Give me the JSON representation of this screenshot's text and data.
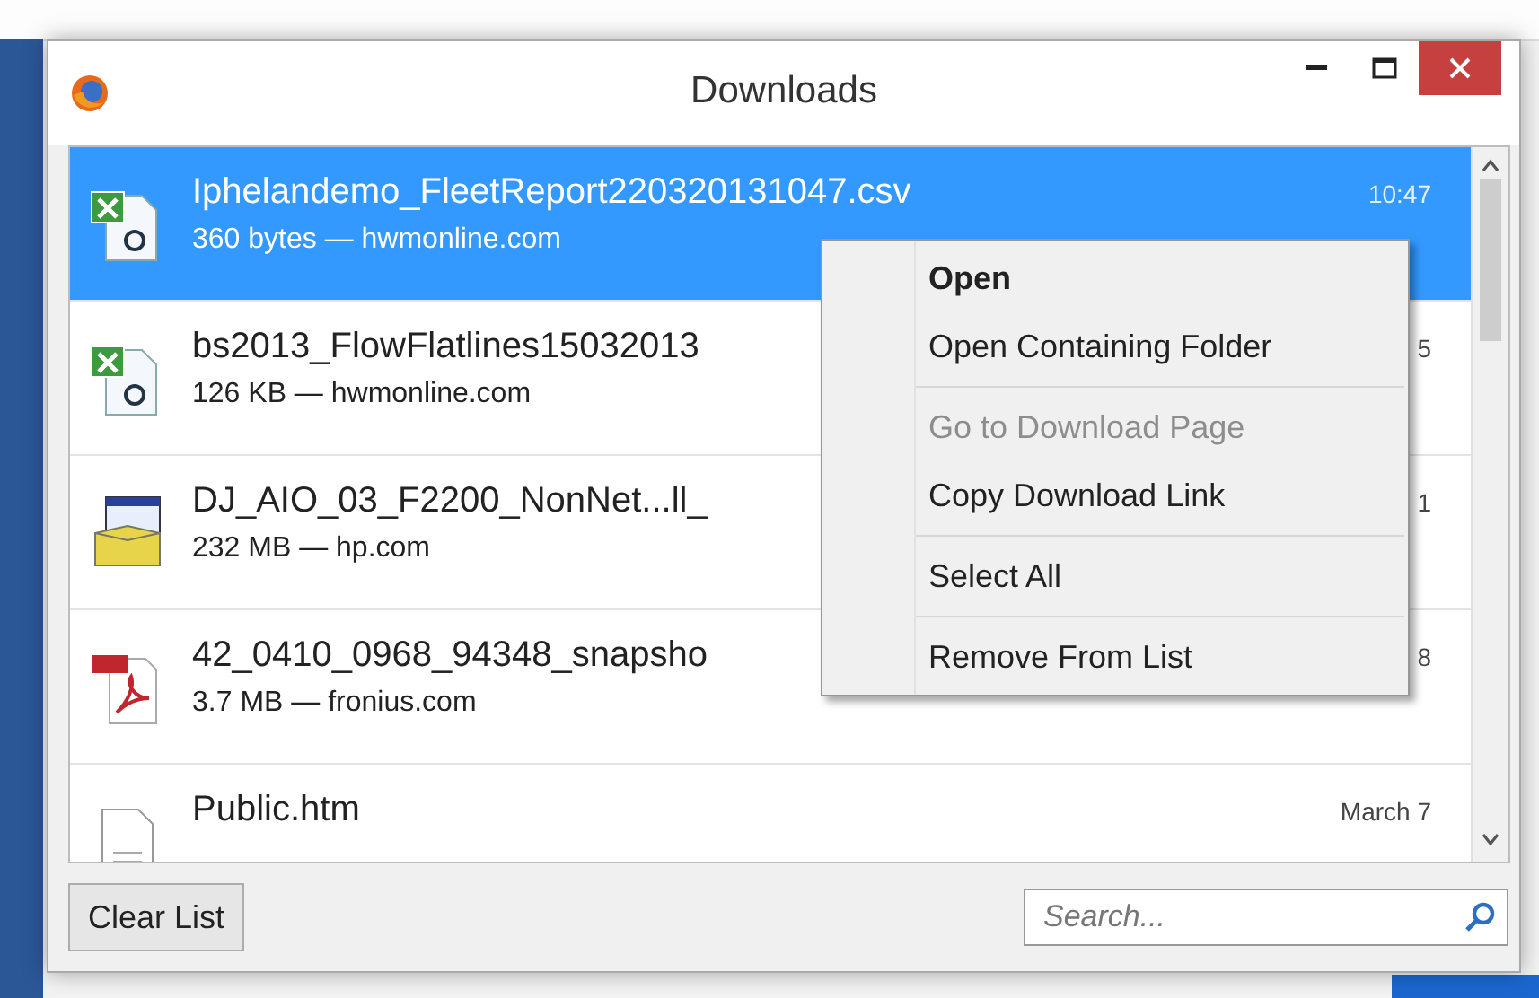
{
  "window": {
    "title": "Downloads"
  },
  "downloads": [
    {
      "kind": "spreadsheet",
      "name": "Iphelandemo_FleetReport220320131047.csv",
      "detail": "360 bytes — hwmonline.com",
      "time": "10:47",
      "selected": true
    },
    {
      "kind": "spreadsheet",
      "name": "bs2013_FlowFlatlines15032013",
      "detail": "126 KB — hwmonline.com",
      "time": "5",
      "selected": false
    },
    {
      "kind": "installer",
      "name": "DJ_AIO_03_F2200_NonNet...ll_",
      "detail": "232 MB — hp.com",
      "time": "1",
      "selected": false
    },
    {
      "kind": "pdf",
      "name": "42_0410_0968_94348_snapsho",
      "detail": "3.7 MB — fronius.com",
      "time": "8",
      "selected": false
    },
    {
      "kind": "page",
      "name": "Public.htm",
      "time": "March 7",
      "selected": false
    }
  ],
  "context_menu": [
    {
      "kind": "item",
      "label": "Open",
      "default": true,
      "disabled": false
    },
    {
      "kind": "item",
      "label": "Open Containing Folder",
      "default": false,
      "disabled": false
    },
    {
      "kind": "separator"
    },
    {
      "kind": "item",
      "label": "Go to Download Page",
      "default": false,
      "disabled": true
    },
    {
      "kind": "item",
      "label": "Copy Download Link",
      "default": false,
      "disabled": false
    },
    {
      "kind": "separator"
    },
    {
      "kind": "item",
      "label": "Select All",
      "default": false,
      "disabled": false
    },
    {
      "kind": "separator"
    },
    {
      "kind": "item",
      "label": "Remove From List",
      "default": false,
      "disabled": false
    }
  ],
  "clear_button": {
    "label": "Clear List"
  },
  "search": {
    "placeholder": "Search..."
  }
}
